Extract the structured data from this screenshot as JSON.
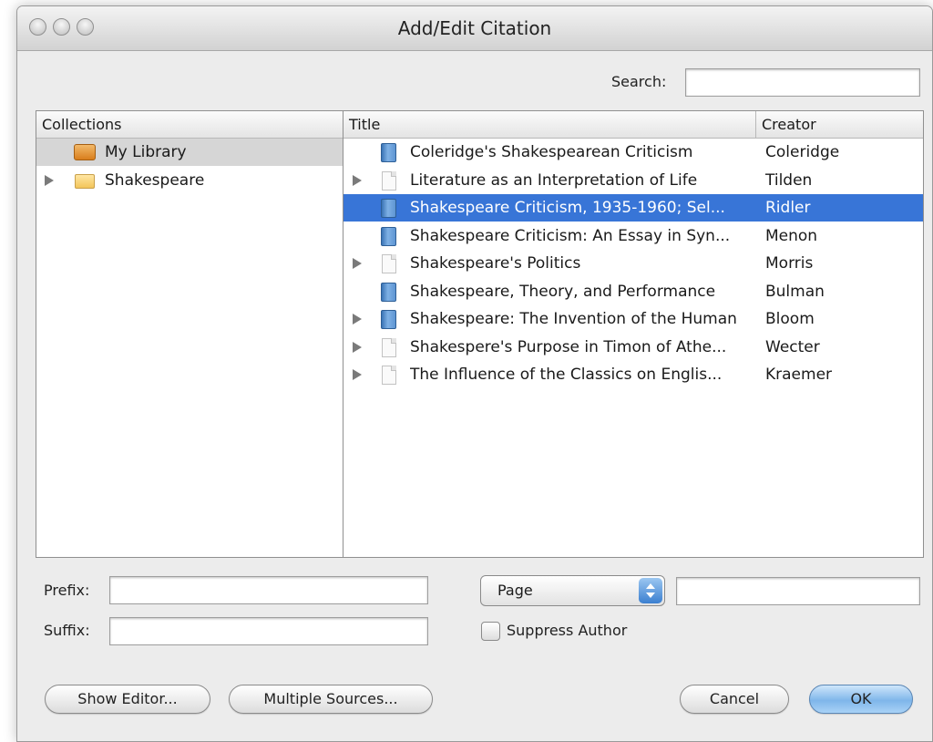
{
  "window": {
    "title": "Add/Edit Citation"
  },
  "search": {
    "label": "Search:",
    "value": ""
  },
  "collections": {
    "header": "Collections",
    "items": [
      {
        "label": "My Library",
        "icon": "library-icon",
        "selected": true
      },
      {
        "label": "Shakespeare",
        "icon": "folder-icon",
        "expandable": true
      }
    ]
  },
  "items": {
    "headers": {
      "title": "Title",
      "creator": "Creator"
    },
    "rows": [
      {
        "title": "Coleridge's Shakespearean Criticism",
        "creator": "Coleridge",
        "icon": "book-icon",
        "expandable": false,
        "selected": false
      },
      {
        "title": "Literature as an Interpretation of Life",
        "creator": "Tilden",
        "icon": "document-icon",
        "expandable": true,
        "selected": false
      },
      {
        "title": "Shakespeare Criticism, 1935-1960; Sel...",
        "creator": "Ridler",
        "icon": "book-icon",
        "expandable": false,
        "selected": true
      },
      {
        "title": "Shakespeare Criticism: An Essay in Syn...",
        "creator": "Menon",
        "icon": "book-icon",
        "expandable": false,
        "selected": false
      },
      {
        "title": "Shakespeare's Politics",
        "creator": "Morris",
        "icon": "document-icon",
        "expandable": true,
        "selected": false
      },
      {
        "title": "Shakespeare, Theory, and Performance",
        "creator": "Bulman",
        "icon": "book-icon",
        "expandable": false,
        "selected": false
      },
      {
        "title": "Shakespeare: The Invention of the Human",
        "creator": "Bloom",
        "icon": "book-icon",
        "expandable": true,
        "selected": false
      },
      {
        "title": "Shakespere's Purpose in Timon of Athe...",
        "creator": "Wecter",
        "icon": "document-icon",
        "expandable": true,
        "selected": false
      },
      {
        "title": "The Influence of the Classics on Englis...",
        "creator": "Kraemer",
        "icon": "document-icon",
        "expandable": true,
        "selected": false
      }
    ]
  },
  "citation": {
    "prefix_label": "Prefix:",
    "prefix_value": "",
    "suffix_label": "Suffix:",
    "suffix_value": "",
    "locator_type": "Page",
    "locator_value": "",
    "suppress_author_label": "Suppress Author",
    "suppress_author_checked": false
  },
  "buttons": {
    "show_editor": "Show Editor...",
    "multiple_sources": "Multiple Sources...",
    "cancel": "Cancel",
    "ok": "OK"
  },
  "colors": {
    "selection": "#3875d7",
    "default_button": "#7fb6ea"
  }
}
